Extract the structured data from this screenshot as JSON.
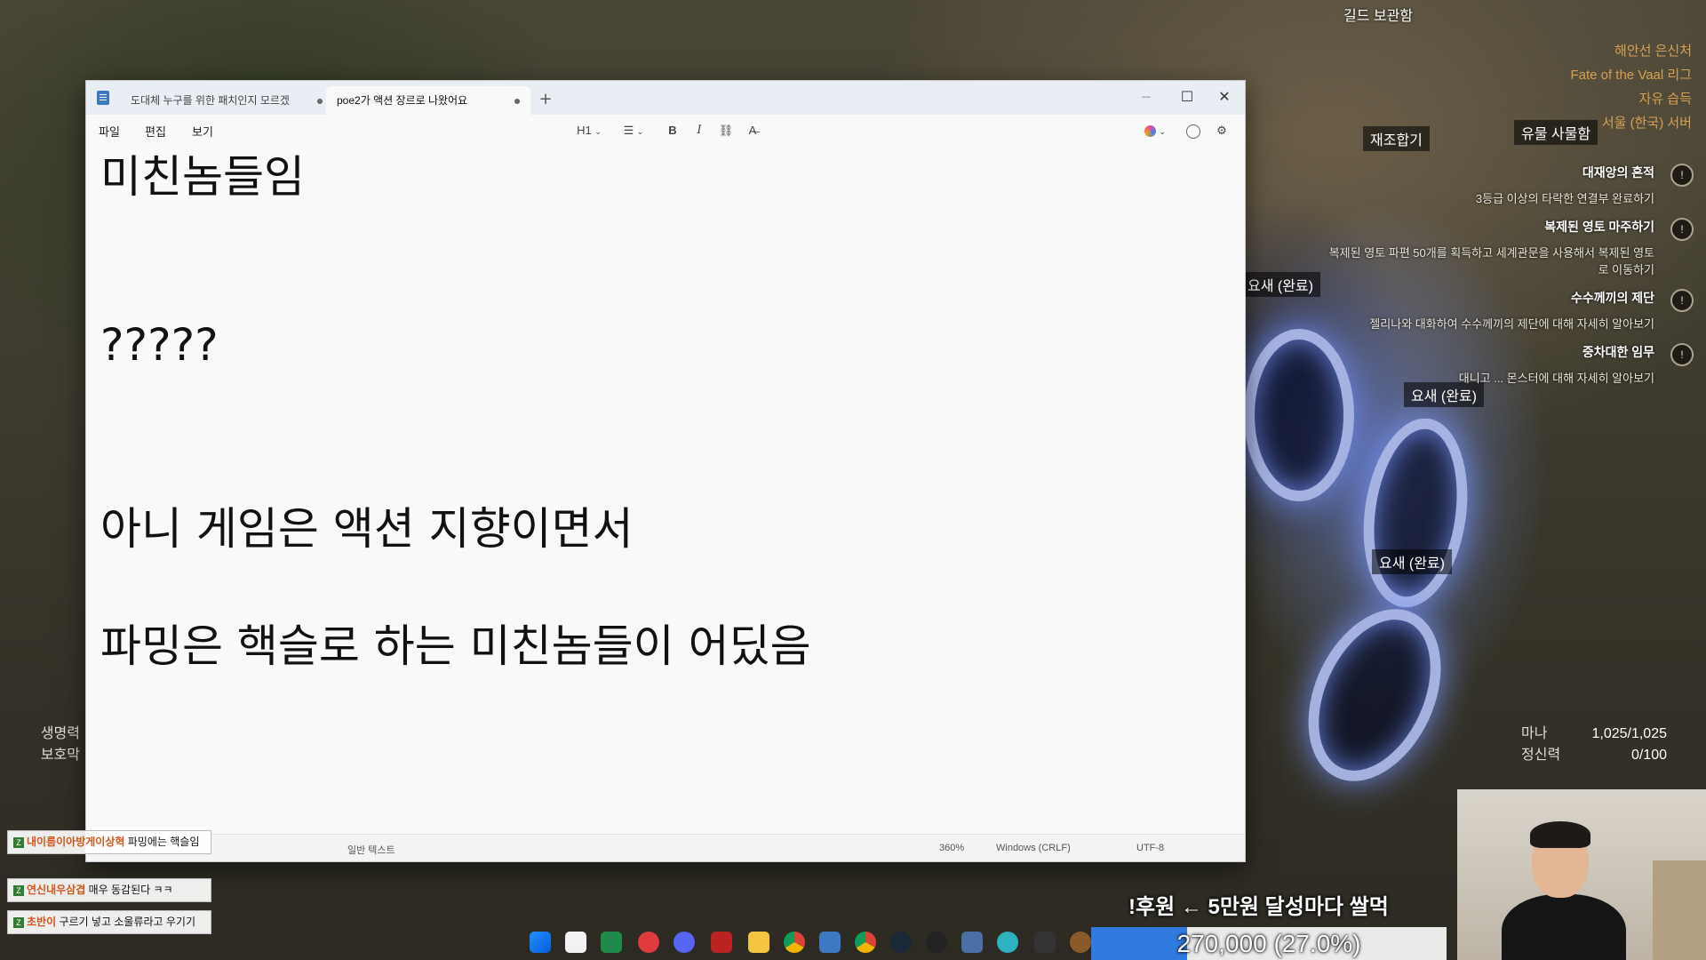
{
  "game": {
    "guild_storage": "길드 보관함",
    "crafting_bench": "재조합기",
    "relic_chest": "유물 사물함",
    "waypoint_labels": [
      "요새 (완료)",
      "요새 (완료)",
      "요새 (완료)"
    ],
    "server_info": [
      "해안선 은신처",
      "Fate of the Vaal 리그",
      "자유 습득",
      "서울 (한국) 서버"
    ],
    "quests": [
      {
        "title": "대재앙의 흔적",
        "desc": "3등급 이상의 타락한 연결부 완료하기"
      },
      {
        "title": "복제된 영토 마주하기",
        "desc": "복제된 영토 파편 50개를 획득하고 세계관문을 사용해서 복제된 영토로 이동하기"
      },
      {
        "title": "수수께끼의 제단",
        "desc": "젤리나와 대화하여 수수께끼의 제단에 대해 자세히 알아보기"
      },
      {
        "title": "중차대한 임무",
        "desc": "대니고 ... 몬스터에 대해 자세히 알아보기"
      }
    ],
    "left_stats": [
      "생명력",
      "보호막"
    ],
    "mana_label": "마나",
    "mana_value": "1,025/1,025",
    "spirit_label": "정신력",
    "spirit_value": "0/100"
  },
  "notepad": {
    "tabs": [
      {
        "label": "도대체 누구를 위한 패치인지 모르겠",
        "active": false
      },
      {
        "label": "poe2가 액션 장르로 나왔어요",
        "active": true
      }
    ],
    "tab_add": "+",
    "window_controls": {
      "minimize": "—",
      "maximize": "☐",
      "close": "✕"
    },
    "menu": [
      "파일",
      "편집",
      "보기"
    ],
    "format": {
      "heading": "H1",
      "list": "☰",
      "bold": "B",
      "italic": "I",
      "link": "⛓",
      "clear": "A̶"
    },
    "lines": [
      "미친놈들임",
      "?????",
      "아니 게임은 액션 지향이면서",
      "파밍은 핵슬로 하는 미친놈들이 어딨음"
    ],
    "status": {
      "type": "일반 텍스트",
      "zoom": "360%",
      "line_ending": "Windows (CRLF)",
      "encoding": "UTF-8"
    }
  },
  "chat": [
    {
      "user": "내이름이아방게이상혁",
      "text": "파밍에는 핵슬임"
    },
    {
      "user": "연신내우삼겹",
      "text": "매우 동감된다 ㅋㅋ"
    },
    {
      "user": "초반이",
      "text": "구르기 넣고 소울류라고 우기기"
    }
  ],
  "donation": {
    "note": "!후원 ← 5만원 달성마다 쌀먹",
    "progress_text": "270,000 (27.0%)",
    "progress_fraction": 0.27
  }
}
